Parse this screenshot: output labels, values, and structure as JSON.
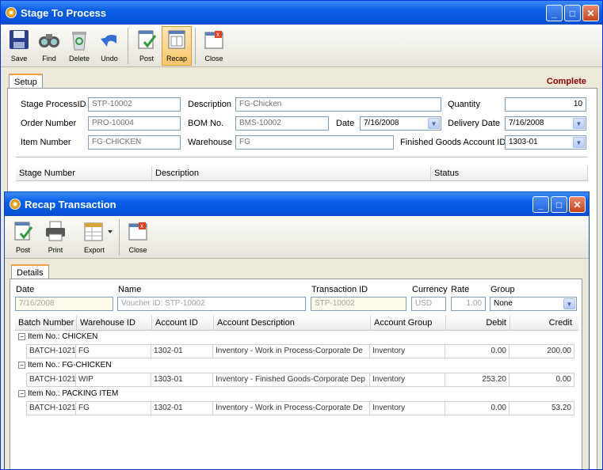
{
  "main_window": {
    "title": "Stage To Process",
    "toolbar": [
      "Save",
      "Find",
      "Delete",
      "Undo",
      "Post",
      "Recap",
      "Close"
    ],
    "tab": "Setup",
    "status": "Complete",
    "fields": {
      "stage_process_id_label": "Stage ProcessID",
      "stage_process_id": "STP-10002",
      "description_label": "Description",
      "description": "FG-Chicken",
      "quantity_label": "Quantity",
      "quantity": "10",
      "order_number_label": "Order Number",
      "order_number": "PRO-10004",
      "bom_label": "BOM No.",
      "bom": "BMS-10002",
      "date_label": "Date",
      "date": "7/16/2008",
      "delivery_date_label": "Delivery Date",
      "delivery_date": "7/16/2008",
      "item_number_label": "Item Number",
      "item_number": "FG-CHICKEN",
      "warehouse_label": "Warehouse",
      "warehouse": "FG",
      "fg_account_label": "Finished Goods Account ID",
      "fg_account": "1303-01"
    },
    "grid_headers": [
      "Stage Number",
      "Description",
      "Status"
    ]
  },
  "recap_window": {
    "title": "Recap Transaction",
    "toolbar": [
      "Post",
      "Print",
      "Export",
      "Close"
    ],
    "tab": "Details",
    "fields": {
      "date_label": "Date",
      "date": "7/16/2008",
      "name_label": "Name",
      "name": "Voucher ID: STP-10002",
      "transaction_id_label": "Transaction ID",
      "transaction_id": "STP-10002",
      "currency_label": "Currency",
      "currency": "USD",
      "rate_label": "Rate",
      "rate": "1.00",
      "group_label": "Group",
      "group": "None"
    },
    "grid_headers": [
      "Batch Number",
      "Warehouse ID",
      "Account ID",
      "Account Description",
      "Account Group",
      "Debit",
      "Credit"
    ],
    "groups": [
      {
        "label": "Item No.: CHICKEN",
        "row": [
          "BATCH-1021",
          "FG",
          "1302-01",
          "Inventory - Work in Process-Corporate De",
          "Inventory",
          "0.00",
          "200.00"
        ]
      },
      {
        "label": "Item No.: FG-CHICKEN",
        "row": [
          "BATCH-1021",
          "WIP",
          "1303-01",
          "Inventory - Finished Goods-Corporate Dep",
          "Inventory",
          "253.20",
          "0.00"
        ]
      },
      {
        "label": "Item No.: PACKING ITEM",
        "row": [
          "BATCH-1021",
          "FG",
          "1302-01",
          "Inventory - Work in Process-Corporate De",
          "Inventory",
          "0.00",
          "53.20"
        ]
      }
    ]
  },
  "colors": {
    "title_bar": "#0a5fe8",
    "status_complete": "#8b0000",
    "active_tool": "#f7c76a"
  }
}
